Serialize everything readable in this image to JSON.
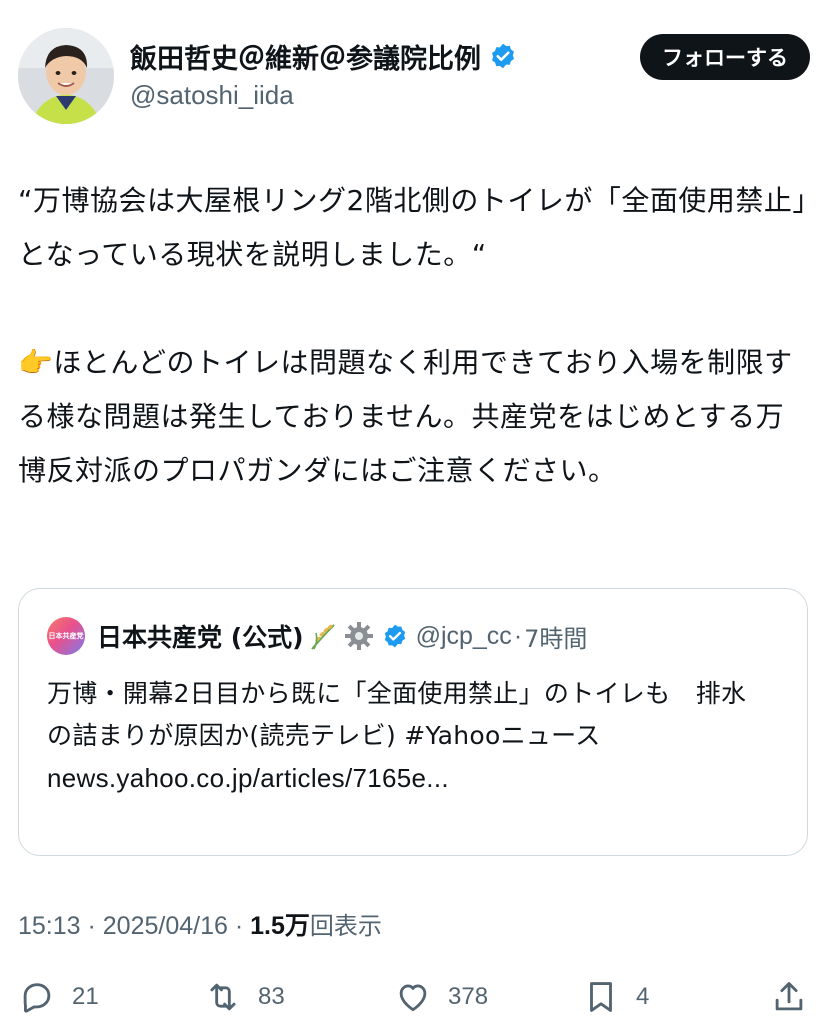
{
  "author": {
    "name": "飯田哲史＠維新＠参議院比例",
    "handle": "@satoshi_iida",
    "verified": true,
    "follow_label": "フォローする"
  },
  "tweet": {
    "lines": [
      "“万博協会は大屋根リング2階北側のトイレが「全面使用禁止」となっている現状を説明しました。“",
      "👉ほとんどのトイレは問題なく利用できており入場を制限する様な問題は発生しておりません。共産党をはじめとする万博反対派のプロパガンダにはご注意ください。"
    ]
  },
  "quote": {
    "avatar_label": "日本共産党",
    "name": "日本共産党 (公式)",
    "handle": "@jcp_cc",
    "separator": "·",
    "time": "7時間",
    "text": "万博・開幕2日目から既に「全面使用禁止」のトイレも　排水の詰まりが原因か(読売テレビ) #Yahooニュース",
    "link": "news.yahoo.co.jp/articles/7165e..."
  },
  "meta": {
    "time": "15:13",
    "sep1": " · ",
    "date": "2025/04/16",
    "sep2": " · ",
    "views": "1.5万",
    "views_label": "回表示"
  },
  "actions": {
    "replies": "21",
    "retweets": "83",
    "likes": "378",
    "bookmarks": "4"
  },
  "colors": {
    "verified": "#1d9bf0",
    "muted": "#536471",
    "text": "#0f1419",
    "border": "#cfd9de"
  }
}
